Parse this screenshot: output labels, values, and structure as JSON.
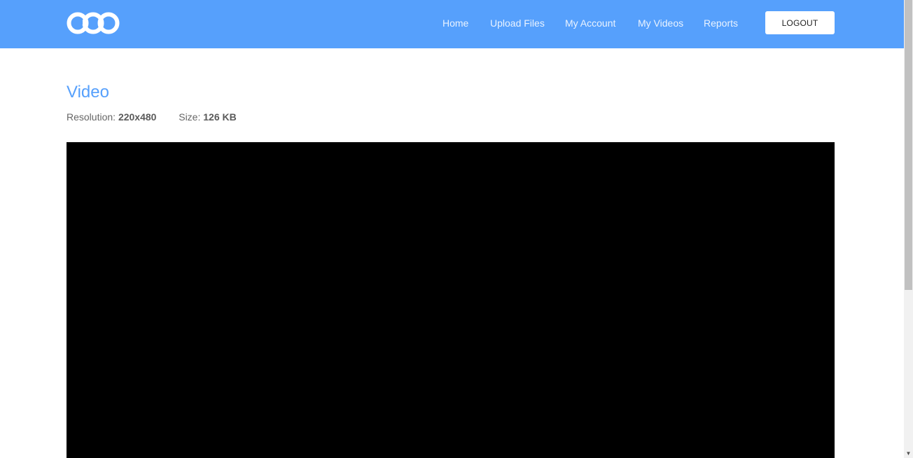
{
  "header": {
    "logo_icon": "goo-logo-icon",
    "brand_color": "#56a0fc",
    "nav": [
      {
        "label": "Home"
      },
      {
        "label": "Upload Files"
      },
      {
        "label": "My Account"
      },
      {
        "label": "My Videos"
      },
      {
        "label": "Reports"
      }
    ],
    "logout_label": "LOGOUT"
  },
  "main": {
    "title": "Video",
    "resolution_label": "Resolution:",
    "resolution_value": "220x480",
    "size_label": "Size:",
    "size_value": "126 KB"
  },
  "scrollbar": {
    "down_icon": "arrow-down-icon"
  }
}
